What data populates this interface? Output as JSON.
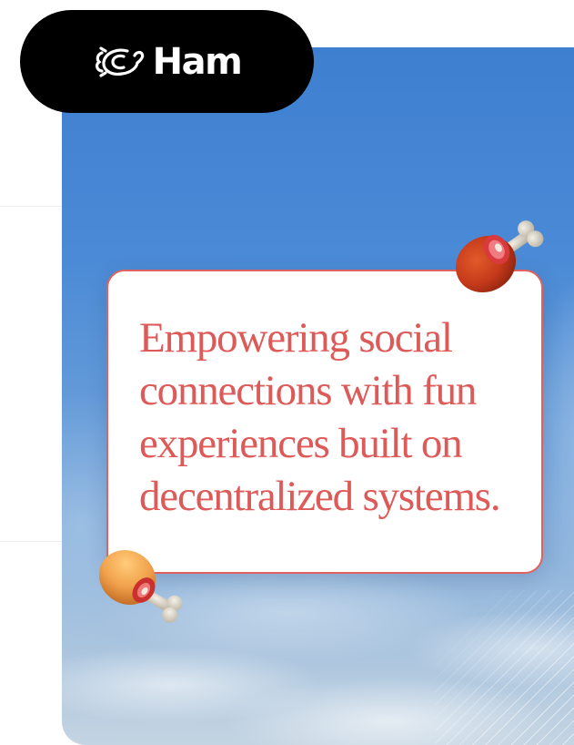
{
  "brand": {
    "name": "Ham",
    "logo_icon": "ham-logo-icon",
    "pill_color": "#000000",
    "text_color": "#ffffff"
  },
  "hero": {
    "background": "sky-with-clouds",
    "quote_lines": [
      "Empowering social",
      "connections with fun",
      "experiences built on",
      "decentralized systems."
    ],
    "accent_color": "#dd5a58"
  },
  "decorations": {
    "top_icon": "ham-drumstick-icon",
    "bottom_icon": "ham-drumstick-icon"
  }
}
